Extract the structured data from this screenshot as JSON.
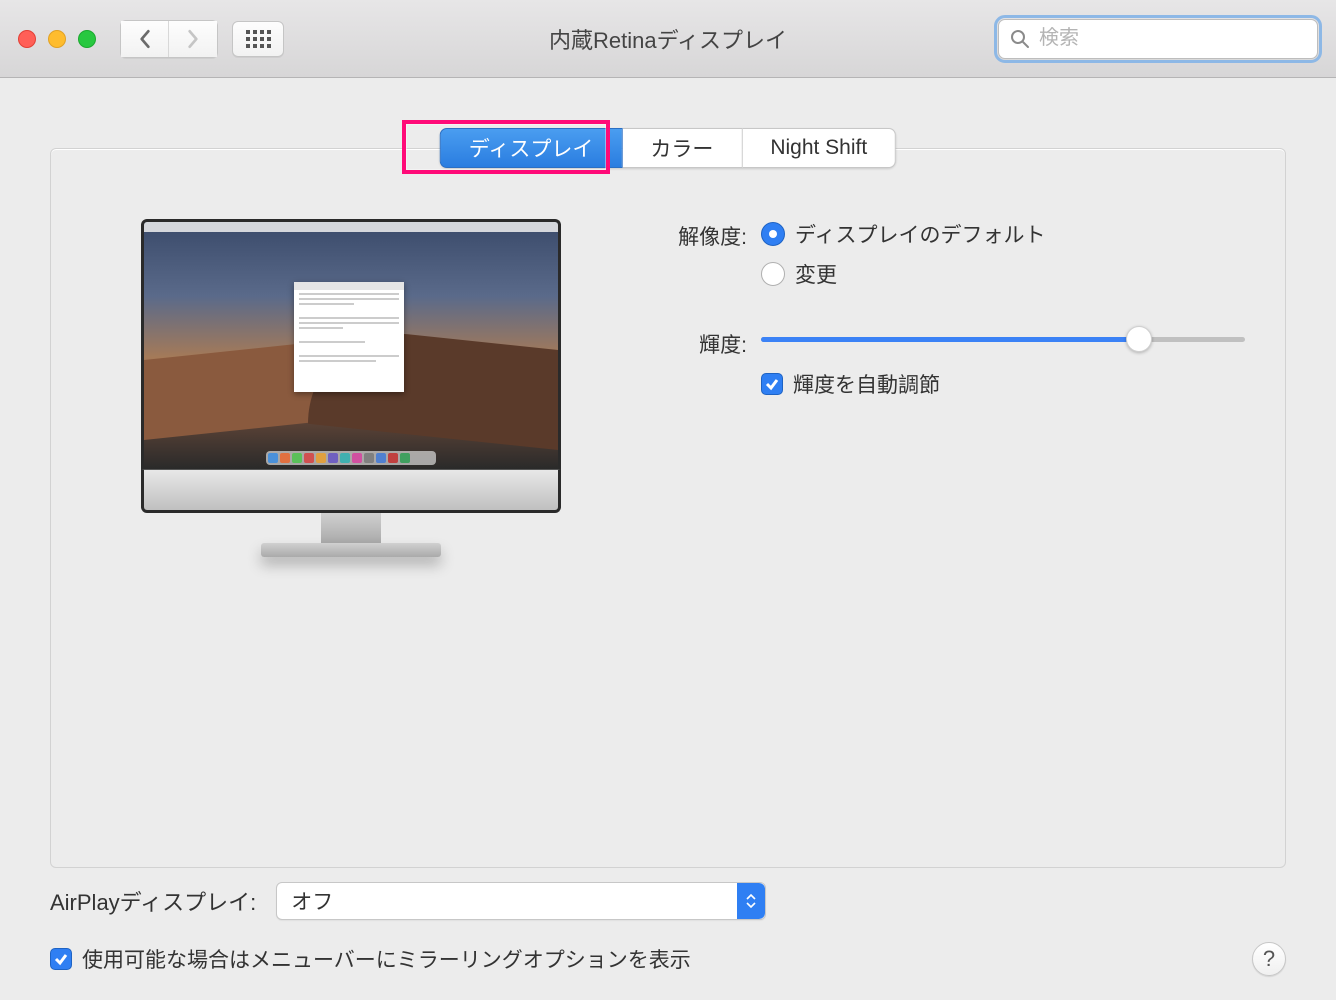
{
  "window": {
    "title": "内蔵Retinaディスプレイ",
    "search_placeholder": "検索"
  },
  "tabs": [
    {
      "label": "ディスプレイ",
      "active": true,
      "highlighted": true
    },
    {
      "label": "カラー",
      "active": false
    },
    {
      "label": "Night Shift",
      "active": false
    }
  ],
  "settings": {
    "resolution": {
      "label": "解像度:",
      "options": [
        {
          "label": "ディスプレイのデフォルト",
          "selected": true
        },
        {
          "label": "変更",
          "selected": false
        }
      ]
    },
    "brightness": {
      "label": "輝度:",
      "value_percent": 78,
      "auto_adjust_label": "輝度を自動調節",
      "auto_adjust_checked": true
    }
  },
  "airplay": {
    "label": "AirPlayディスプレイ:",
    "value": "オフ"
  },
  "mirroring": {
    "checked": true,
    "label": "使用可能な場合はメニューバーにミラーリングオプションを表示"
  },
  "help": "?"
}
